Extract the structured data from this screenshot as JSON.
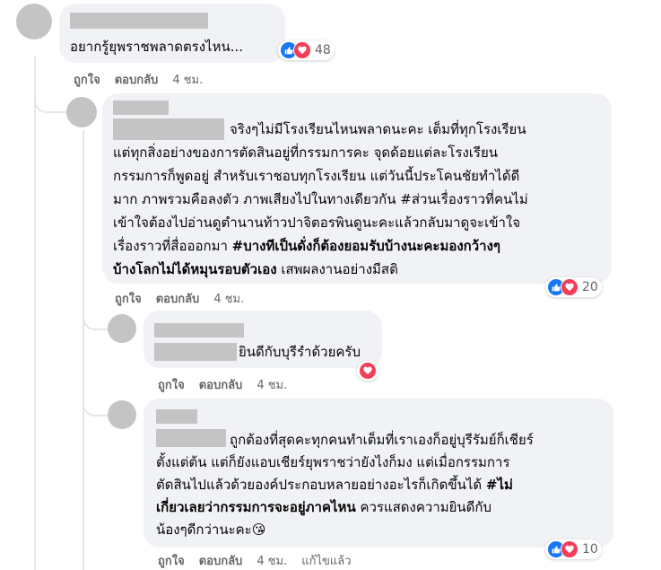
{
  "comments": [
    {
      "text_lines": [
        "อยากรู้ยุพราชพลาดตรงไหน..."
      ],
      "actions": {
        "like": "ถูกใจ",
        "reply": "ตอบกลับ",
        "time": "4 ชม."
      },
      "reaction_count": "48"
    },
    {
      "text_lines": [
        "จริงๆไม่มีโรงเรียนไหนพลาดนะคะ เต็มที่ทุกโรงเรียน",
        "แต่ทุกสิ่งอย่างของการตัดสินอยู่ที่กรรมการคะ จุดด้อยแต่ละโรงเรียน",
        "กรรมการก็พูดอยู่ สำหรับเราชอบทุกโรงเรียน แต่วันนี้ประโคนชัยทำได้ดี",
        "มาก ภาพรวมคือลงตัว ภาพเสียงไปในทางเดียวกัน #ส่วนเรื่องราวที่คนไม่",
        "เข้าใจต้องไปอ่านดูตำนานท้าวปาจิตอรพินดูนะคะแล้วกลับมาดูจะเข้าใจ"
      ],
      "line6_normal": "เรื่องราวที่สื่อออกมา ",
      "line6_bold": "#บางทีเป็นดั่งก็ต้องยอมรับบ้างนะคะมองกว้างๆ",
      "line7_bold": "บ้างโลกไม่ได้หมุนรอบตัวเอง",
      "line7_normal": " เสพผลงานอย่างมีสติ",
      "actions": {
        "like": "ถูกใจ",
        "reply": "ตอบกลับ",
        "time": "4 ชม."
      },
      "reaction_count": "20"
    },
    {
      "text_lines": [
        "ยินดีกับบุรีรำด้วยครับ"
      ],
      "actions": {
        "like": "ถูกใจ",
        "reply": "ตอบกลับ",
        "time": "4 ชม."
      }
    },
    {
      "line1": "ถูกต้องที่สุดคะทุกคนทำเต็มที่เราเองก็อยู่บุรีรัมย์ก็เชียร์",
      "line2": "ตั้งแต่ต้น แต่ก็ยังแอบเชียร์ยุพราชว่ายังไงก็มง แต่เมื่อกรรมการ",
      "line3_normal": "ตัดสินไปแล้วด้วยองค์ประกอบหลายอย่างอะไรก็เกิดขึ้นได้ ",
      "line3_bold": "#ไม่",
      "line4_bold": "เกี่ยวเลยว่ากรรมการจะอยู่ภาคไหน",
      "line4_normal": " ควรแสดงความยินดีกับ",
      "line5": "น้องๆดีกว่านะคะ",
      "emoji": "😘",
      "actions": {
        "like": "ถูกใจ",
        "reply": "ตอบกลับ",
        "time": "4 ชม.",
        "edited": "แก้ไขแล้ว"
      },
      "reaction_count": "10"
    }
  ],
  "icons": {
    "like": "like-icon",
    "love": "love-icon"
  },
  "colors": {
    "bubble": "#f0f2f5",
    "like": "#1877f2",
    "love": "#f33e58",
    "meta": "#65676b"
  }
}
